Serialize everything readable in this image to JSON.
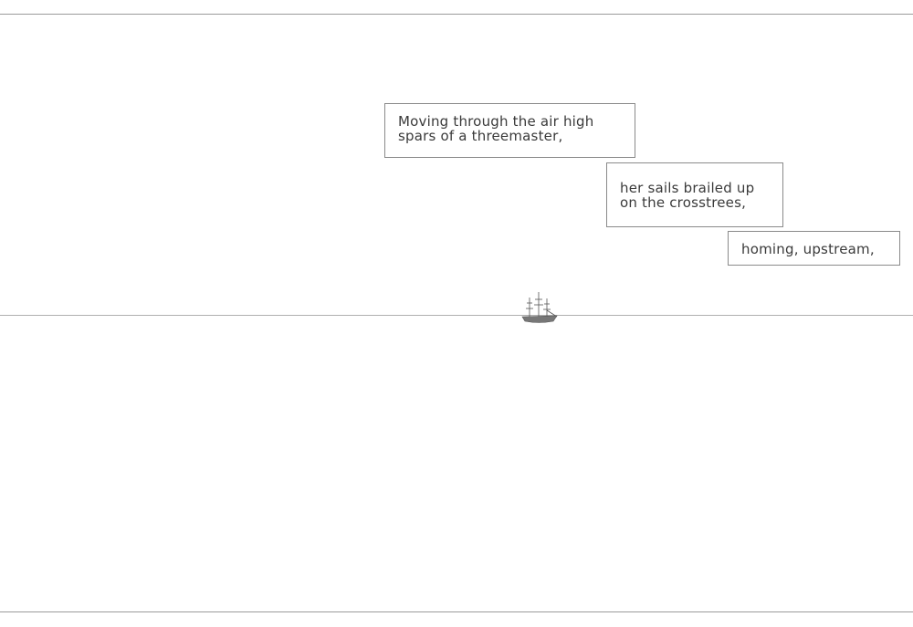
{
  "captions": [
    {
      "lines": [
        "Moving through the air high",
        "spars of a threemaster,"
      ]
    },
    {
      "lines": [
        "her sails brailed up",
        "on the crosstrees,"
      ]
    },
    {
      "lines": [
        "homing, upstream,"
      ]
    }
  ],
  "colors": {
    "ink": "#3a3a3a",
    "border": "#8a8a8a",
    "background": "#ffffff"
  },
  "icons": {
    "ship": "three-masted-ship-icon"
  }
}
